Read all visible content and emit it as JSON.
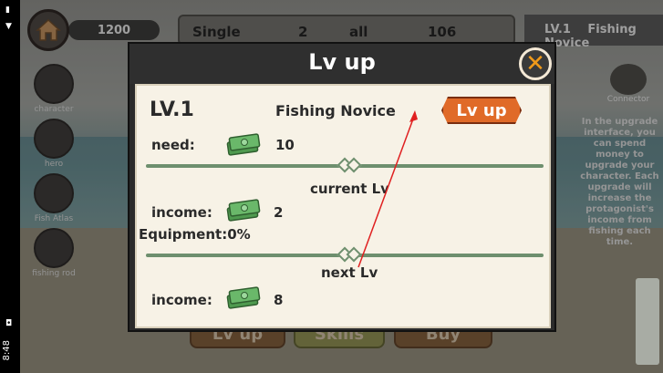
{
  "status": {
    "time": "8:48"
  },
  "hud": {
    "coins": "1200",
    "single_label": "Single",
    "single_value": "2",
    "all_label": "all",
    "all_value": "106",
    "level": "LV.1",
    "title": "Fishing Novice"
  },
  "sidebar": {
    "items": [
      {
        "label": "character"
      },
      {
        "label": "hero"
      },
      {
        "label": "Fish Atlas"
      },
      {
        "label": "fishing rod"
      }
    ]
  },
  "connector_label": "Connector",
  "right_info": "In the upgrade interface, you can spend money to upgrade your character. Each upgrade will increase the protagonist's income from fishing each time.",
  "bottom_buttons": [
    "Lv up",
    "Skills",
    "Buy"
  ],
  "modal": {
    "title": "Lv up",
    "level": "LV.1",
    "rank": "Fishing Novice",
    "lvup_button": "Lv up",
    "need_label": "need:",
    "need_value": "10",
    "current_label": "current Lv",
    "current_income_label": "income:",
    "current_income_value": "2",
    "equipment_label": "Equipment:0%",
    "next_label": "next Lv",
    "next_income_label": "income:",
    "next_income_value": "8"
  },
  "colors": {
    "panel_bg": "#f7f2e6",
    "modal_bg": "#2b2b2b",
    "lvup_orange": "#e06a28",
    "close_orange": "#f09a1a",
    "divider_green": "#6e8f6e",
    "money_green": "#5aa85a",
    "arrow_red": "#e02020"
  }
}
